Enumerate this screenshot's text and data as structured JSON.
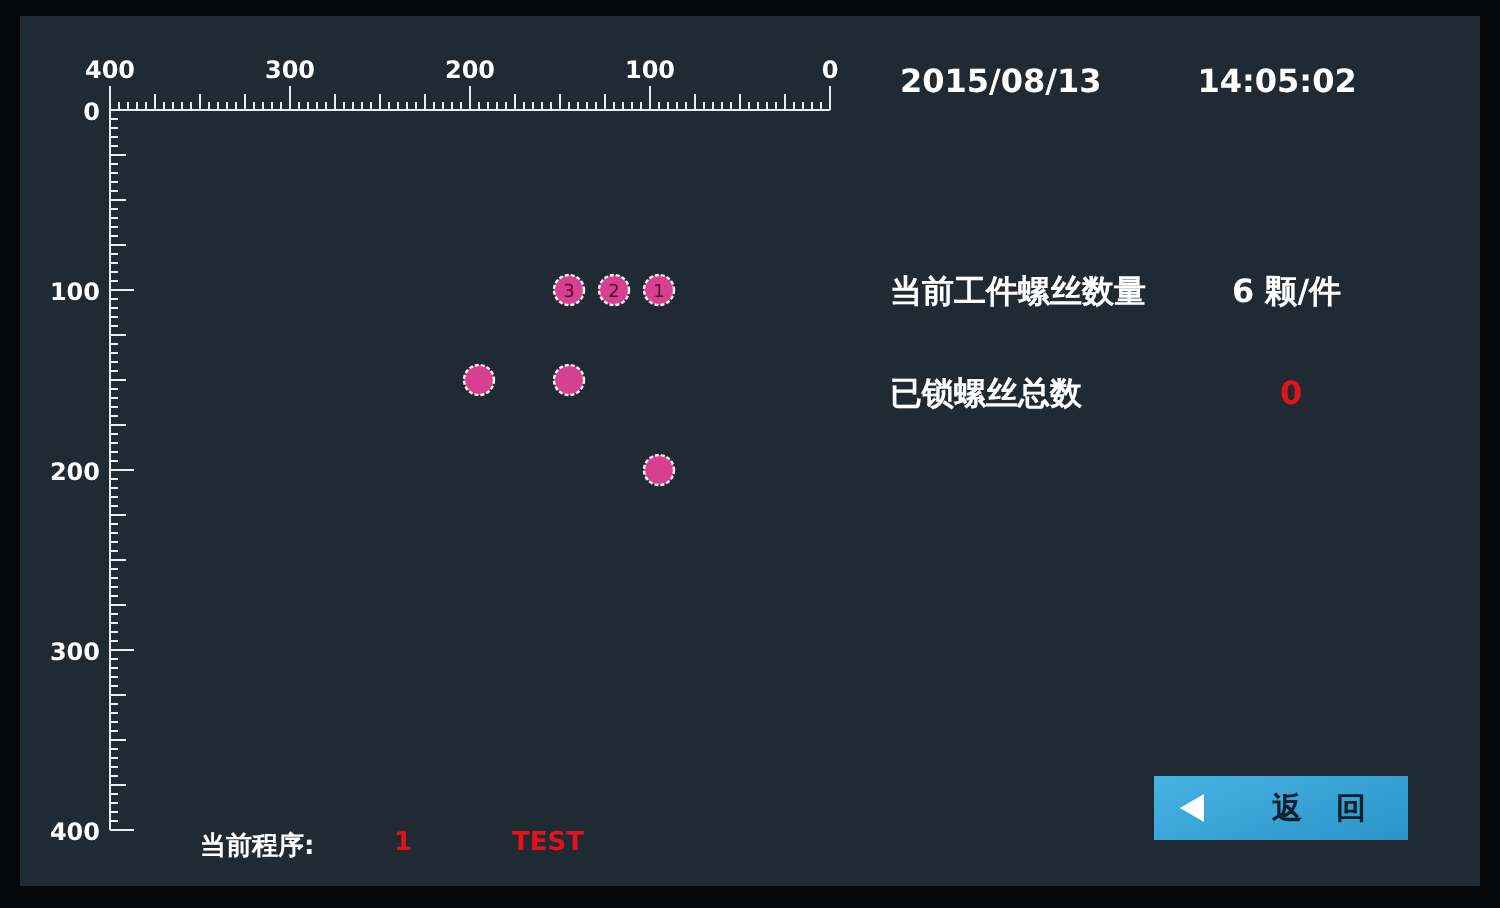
{
  "header": {
    "date": "2015/08/13",
    "time": "14:05:02"
  },
  "layout_view": {
    "chart_data": {
      "type": "scatter",
      "x": [
        95,
        120,
        145,
        145,
        195,
        95
      ],
      "values": [
        100,
        100,
        100,
        150,
        150,
        200
      ],
      "xlim": [
        400,
        0
      ],
      "ylim": [
        400,
        0
      ],
      "xticks": [
        400,
        300,
        200,
        100,
        0
      ],
      "yticks": [
        0,
        100,
        200,
        300,
        400
      ],
      "annotations": [
        {
          "x": 95,
          "y": 100,
          "text": "1"
        },
        {
          "x": 120,
          "y": 100,
          "text": "2"
        },
        {
          "x": 145,
          "y": 100,
          "text": "3"
        }
      ]
    }
  },
  "stats": [
    {
      "label": "当前工件螺丝数量",
      "value": "6 颗/件",
      "kind": "normal"
    },
    {
      "label": "已锁螺丝总数",
      "value": "0",
      "kind": "alert"
    }
  ],
  "program": {
    "label": "当前程序:",
    "number": "1",
    "name": "TEST"
  },
  "buttons": [
    {
      "label": "返 回"
    }
  ]
}
